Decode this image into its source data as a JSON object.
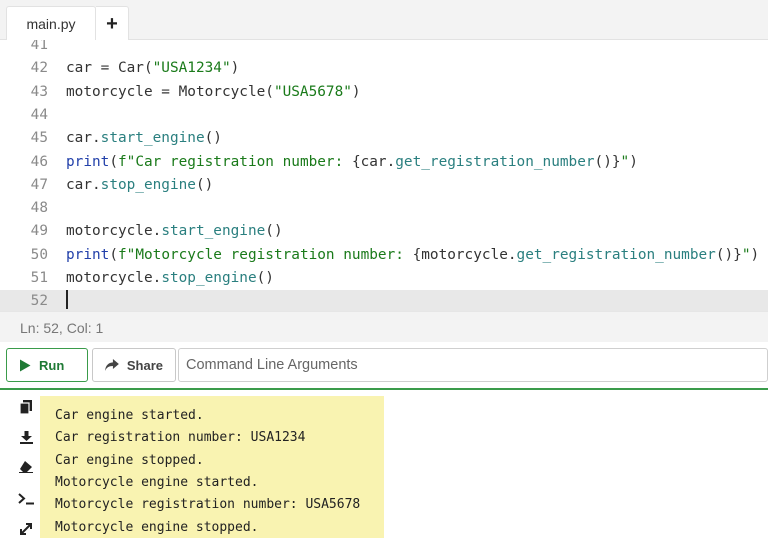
{
  "tabs": {
    "file": "main.py",
    "add": "+"
  },
  "editor": {
    "lines": [
      {
        "num": "41",
        "code": []
      },
      {
        "num": "42",
        "code": [
          [
            "",
            "car = Car("
          ],
          [
            "s",
            "\"USA1234\""
          ],
          [
            "",
            ")"
          ]
        ]
      },
      {
        "num": "43",
        "code": [
          [
            "",
            "motorcycle = Motorcycle("
          ],
          [
            "s",
            "\"USA5678\""
          ],
          [
            "",
            ")"
          ]
        ]
      },
      {
        "num": "44",
        "code": []
      },
      {
        "num": "45",
        "code": [
          [
            "",
            "car."
          ],
          [
            "fn",
            "start_engine"
          ],
          [
            "",
            "()"
          ]
        ]
      },
      {
        "num": "46",
        "code": [
          [
            "k",
            "print"
          ],
          [
            "",
            "("
          ],
          [
            "s",
            "f\"Car registration number: "
          ],
          [
            "",
            "{car."
          ],
          [
            "fn",
            "get_registration_number"
          ],
          [
            "",
            "()}"
          ],
          [
            "s",
            "\""
          ],
          [
            "",
            ")"
          ]
        ]
      },
      {
        "num": "47",
        "code": [
          [
            "",
            "car."
          ],
          [
            "fn",
            "stop_engine"
          ],
          [
            "",
            "()"
          ]
        ]
      },
      {
        "num": "48",
        "code": []
      },
      {
        "num": "49",
        "code": [
          [
            "",
            "motorcycle."
          ],
          [
            "fn",
            "start_engine"
          ],
          [
            "",
            "()"
          ]
        ]
      },
      {
        "num": "50",
        "code": [
          [
            "k",
            "print"
          ],
          [
            "",
            "("
          ],
          [
            "s",
            "f\"Motorcycle registration number: "
          ],
          [
            "",
            "{motorcycle."
          ],
          [
            "fn",
            "get_registration_number"
          ],
          [
            "",
            "()}"
          ],
          [
            "s",
            "\""
          ],
          [
            "",
            ")"
          ]
        ]
      },
      {
        "num": "51",
        "code": [
          [
            "",
            "motorcycle."
          ],
          [
            "fn",
            "stop_engine"
          ],
          [
            "",
            "()"
          ]
        ]
      },
      {
        "num": "52",
        "code": [],
        "active": true,
        "cursor": true
      }
    ]
  },
  "status": {
    "position": "Ln: 52,  Col: 1"
  },
  "toolbar": {
    "run_label": "Run",
    "share_label": "Share",
    "args_placeholder": "Command Line Arguments"
  },
  "output": {
    "icons": [
      "copy-icon",
      "download-icon",
      "eraser-icon",
      "terminal-icon",
      "expand-icon"
    ],
    "lines": [
      "Car engine started.",
      "Car registration number: USA1234",
      "Car engine stopped.",
      "Motorcycle engine started.",
      "Motorcycle registration number: USA5678",
      "Motorcycle engine stopped."
    ]
  },
  "colors": {
    "accent_green": "#3a9b4a",
    "output_highlight": "#f9f3b1",
    "string": "#1a7a1a",
    "keyword": "#2240aa",
    "method": "#2a7f7f"
  }
}
